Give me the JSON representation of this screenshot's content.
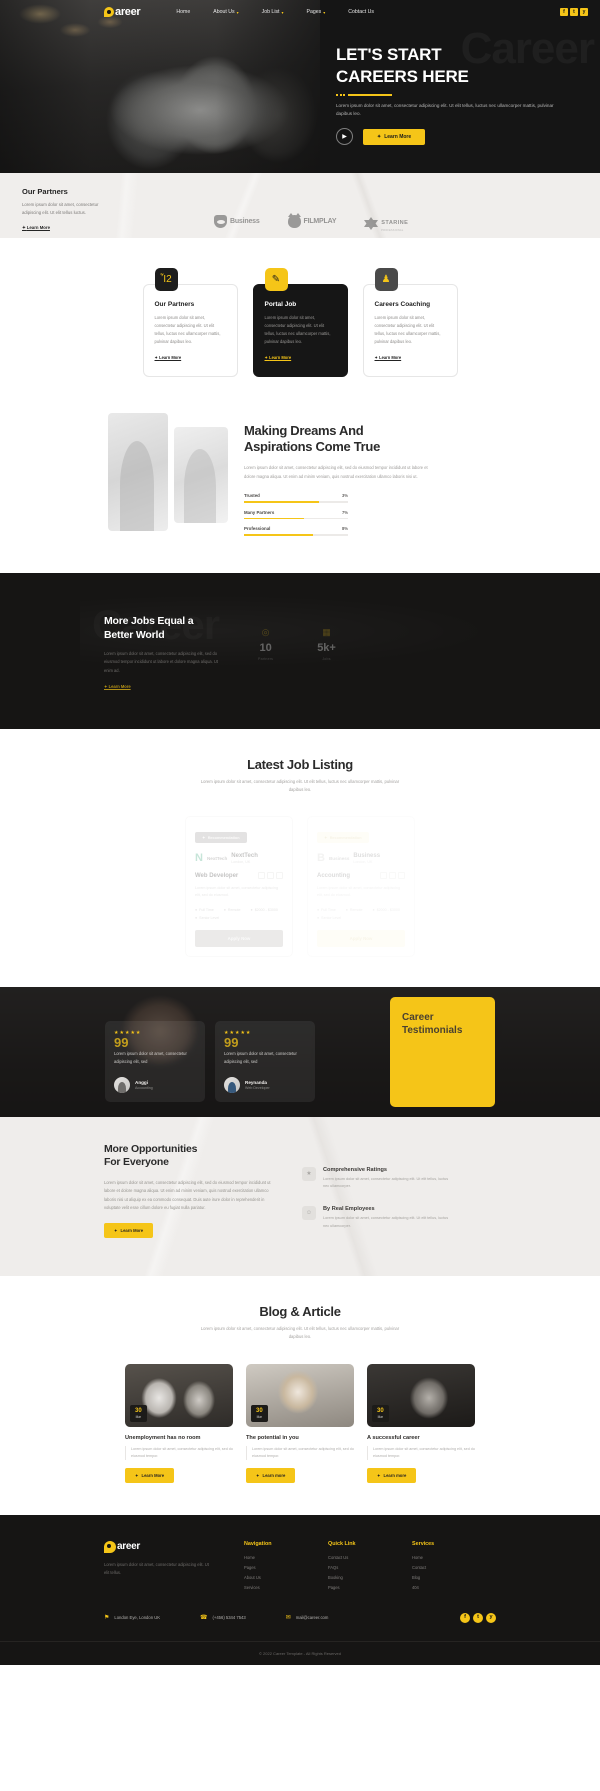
{
  "header": {
    "brand": "areer",
    "nav": [
      {
        "label": "Home",
        "caret": false
      },
      {
        "label": "About Us",
        "caret": true
      },
      {
        "label": "Job List",
        "caret": true
      },
      {
        "label": "Pages",
        "caret": true
      },
      {
        "label": "Cobtact Us",
        "caret": false
      }
    ],
    "socials": [
      "f",
      "t",
      "y"
    ]
  },
  "hero": {
    "ghost": "Career",
    "title_line1": "LET'S START",
    "title_line2": "CAREERS HERE",
    "subtitle": "Lorem ipsum dolor sit amet, consectetur adipiscing elit. Ut elit tellus, luctus nec ullamcorper mattis, pulvinar dapibus leo.",
    "play_label": "▶",
    "cta": "Learn More"
  },
  "partners": {
    "title": "Our Partners",
    "desc": "Lorem ipsum dolor sit amet, consectetur adipiscing elit. Ut elit tellus luctus.",
    "link": "Learn More",
    "logos": [
      {
        "name": "Business",
        "sub": "",
        "shape": "shield"
      },
      {
        "name": "FILMPLAY",
        "sub": "",
        "shape": "cat"
      },
      {
        "name": "STARINE",
        "sub": "PROFESSIONAL",
        "shape": "star"
      }
    ]
  },
  "services": {
    "cards": [
      {
        "icon": "briefcase-icon",
        "glyph": "Ἶ2",
        "title": "Our Partners",
        "desc": "Lorem ipsum dolor sit amet, consectetur adipiscing elit. Ut elit tellus, luctus nec ullamcorper mattis, pulvinar dapibus leo.",
        "link": "Learn More",
        "style": "light",
        "icon_style": "dark"
      },
      {
        "icon": "document-edit-icon",
        "glyph": "✎",
        "title": "Portal Job",
        "desc": "Lorem ipsum dolor sit amet, consectetur adipiscing elit. Ut elit tellus, luctus nec ullamcorper mattis, pulvinar dapibus leo.",
        "link": "Learn More",
        "style": "dark",
        "icon_style": "yellow"
      },
      {
        "icon": "user-tie-icon",
        "glyph": "♟",
        "title": "Careers Coaching",
        "desc": "Lorem ipsum dolor sit amet, consectetur adipiscing elit. Ut elit tellus, luctus nec ullamcorper mattis, pulvinar dapibus leo.",
        "link": "Learn More",
        "style": "light",
        "icon_style": "gray"
      }
    ]
  },
  "about": {
    "heading_line1": "Making Dreams And",
    "heading_line2": "Aspirations Come True",
    "desc": "Lorem ipsum dolor sit amet, consectetur adipiscing elit, sed do eiusmod tempor incididunt ut labore et dolore magna aliqua. Ut enim ad minim veniam, quis nostrud exercitation ullamco laboris nisi ut.",
    "skills": [
      {
        "name": "Trusted",
        "value": "3%",
        "pct": 72
      },
      {
        "name": "Many Partners",
        "value": "7%",
        "pct": 58
      },
      {
        "name": "Professional",
        "value": "8%",
        "pct": 66
      }
    ]
  },
  "dark_stats": {
    "ghost": "Career",
    "heading_line1": "More Jobs Equal a",
    "heading_line2": "Better World",
    "desc": "Lorem ipsum dolor sit amet, consectetur adipiscing elit, sed do eiusmod tempor incididunt ut labore et dolore magna aliqua. Ut enim ad.",
    "link": "Learn More",
    "stats": [
      {
        "icon": "camera-icon",
        "glyph": "◎",
        "number": "10",
        "title": "Partners"
      },
      {
        "icon": "chart-icon",
        "glyph": "▦",
        "number": "5k+",
        "title": "Jobs"
      }
    ]
  },
  "jobs": {
    "title": "Latest Job Listing",
    "subtitle": "Lorem ipsum dolor sit amet, consectetur adipiscing elit. Ut elit tellus, luctus nec ullamcorper mattis, pulvinar dapibus leo.",
    "cards": [
      {
        "badge": "Recommendation",
        "badge_style": "gray",
        "company": "NextTech",
        "company_mark": "N",
        "location": "London, UK",
        "role": "Web Developer",
        "desc": "Lorem ipsum dolor sit amet, consectetur adipiscing elit, sed do eiusmod.",
        "meta": [
          "Full Time",
          "Remote",
          "$2000 - $3000",
          "Senior Level"
        ],
        "button": "Apply Now",
        "button_style": "gray",
        "opacity": "op"
      },
      {
        "badge": "Recommendation",
        "badge_style": "yellow",
        "company": "Business",
        "company_mark": "B",
        "location": "London, UK",
        "role": "Accounting",
        "desc": "Lorem ipsum dolor sit amet, consectetur adipiscing elit, sed do eiusmod.",
        "meta": [
          "Full Time",
          "Remote",
          "$2000 - $3000",
          "Senior Level"
        ],
        "button": "Apply Now",
        "button_style": "yellow",
        "opacity": "op2"
      }
    ]
  },
  "testimonials": {
    "panel_line1": "Career",
    "panel_line2": "Testimonials",
    "cards": [
      {
        "stars": "★★★★★",
        "quote_mark": "99",
        "text": "Lorem ipsum dolor sit amet, consectetur adipiscing elit, sed",
        "name": "Anggi",
        "role": "Accounting"
      },
      {
        "stars": "★★★★★",
        "quote_mark": "99",
        "text": "Lorem ipsum dolor sit amet, consectetur adipiscing elit, sed",
        "name": "Reynanda",
        "role": "Web Developer"
      }
    ]
  },
  "opportunities": {
    "heading_line1": "More Opportunities",
    "heading_line2": "For Everyone",
    "desc": "Lorem ipsum dolor sit amet, consectetur adipiscing elit, sed do eiusmod tempor incididunt ut labore et dolore magna aliqua. Ut enim ad minim veniam, quis nostrud exercitation ullamco laboris nisi ut aliquip ex ea commodo consequat. Duis aute irure dolor in reprehenderit in voluptate velit esse cillum dolore eu fugiat nulla pariatur.",
    "cta": "Learn More",
    "items": [
      {
        "icon": "star-rating-icon",
        "glyph": "★",
        "title": "Comprehensive Ratings",
        "desc": "Lorem ipsum dolor sit amet, consectetur adipiscing elit. Ut elit tellus, luctus nec ullamcorper."
      },
      {
        "icon": "people-icon",
        "glyph": "☺",
        "title": "By Real Employees",
        "desc": "Lorem ipsum dolor sit amet, consectetur adipiscing elit. Ut elit tellus, luctus nec ullamcorper."
      }
    ]
  },
  "blog": {
    "title": "Blog & Article",
    "subtitle": "Lorem ipsum dolor sit amet, consectetur adipiscing elit. Ut elit tellus, luctus nec ullamcorper mattis, pulvinar dapibus leo.",
    "posts": [
      {
        "day": "30",
        "month": "Mar",
        "title": "Unemployment has no room",
        "desc": "Lorem ipsum dolor sit amet, consectetur adipiscing elit, sed do eiusmod tempor.",
        "button": "Learn More"
      },
      {
        "day": "30",
        "month": "Mar",
        "title": "The potential in you",
        "desc": "Lorem ipsum dolor sit amet, consectetur adipiscing elit, sed do eiusmod tempor.",
        "button": "Learn more"
      },
      {
        "day": "30",
        "month": "Mar",
        "title": "A successful career",
        "desc": "Lorem ipsum dolor sit amet, consectetur adipiscing elit, sed do eiusmod tempor.",
        "button": "Learn more"
      }
    ]
  },
  "footer": {
    "brand": "areer",
    "desc": "Lorem ipsum dolor sit amet, consectetur adipiscing elit. Ut elit tellus.",
    "columns": [
      {
        "title": "Navigation",
        "items": [
          "Home",
          "Pages",
          "About Us",
          "Services"
        ]
      },
      {
        "title": "Quick Link",
        "items": [
          "Contact Us",
          "FAQs",
          "Booking",
          "Pages"
        ]
      },
      {
        "title": "Services",
        "items": [
          "Home",
          "Contact",
          "Blog",
          "404"
        ]
      }
    ],
    "contacts": [
      {
        "icon": "location-pin-icon",
        "glyph": "⚑",
        "text": "London Eye, London UK"
      },
      {
        "icon": "phone-icon",
        "glyph": "☎",
        "text": "(+456) 5344 7543"
      },
      {
        "icon": "mail-icon",
        "glyph": "✉",
        "text": "mail@career.com"
      }
    ],
    "socials": [
      "f",
      "t",
      "y"
    ],
    "copyright": "© 2022 Career Template - All Rights Reserved"
  }
}
